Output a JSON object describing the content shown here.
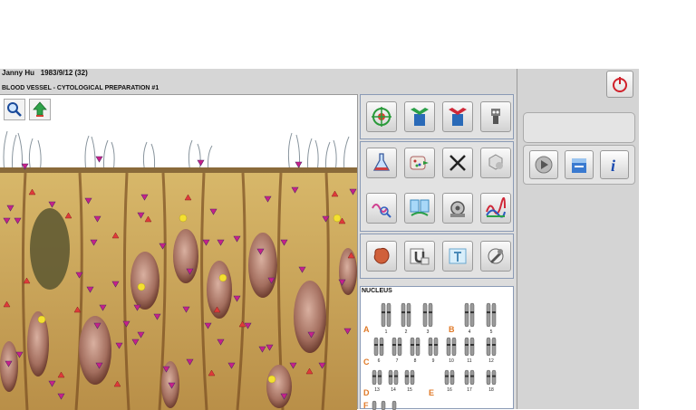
{
  "patient": {
    "name": "Janny  Hu",
    "dob": "1983/9/12 (32)"
  },
  "view": {
    "title": "BLOOD VESSEL - CYTOLOGICAL PREPARATION #1"
  },
  "viewer_tools": [
    {
      "name": "zoom-magnifier-icon"
    },
    {
      "name": "up-arrow-icon"
    }
  ],
  "tool_groups": [
    [
      {
        "name": "target-icon"
      },
      {
        "name": "cube-in-icon"
      },
      {
        "name": "cube-out-icon"
      },
      {
        "name": "robot-tool-icon"
      }
    ],
    [
      {
        "name": "flask-icon"
      },
      {
        "name": "dots-scan-icon"
      },
      {
        "name": "close-x-icon"
      },
      {
        "name": "molecule-icon"
      },
      {
        "name": "wave-zoom-icon"
      },
      {
        "name": "compare-icon"
      },
      {
        "name": "gear-machine-icon"
      },
      {
        "name": "spectrum-icon"
      }
    ],
    [
      {
        "name": "organ-icon"
      },
      {
        "name": "magnet-icon"
      },
      {
        "name": "clipboard-icon"
      },
      {
        "name": "wrench-icon"
      }
    ]
  ],
  "nucleus": {
    "title": "NUCLEUS",
    "groups": [
      "A",
      "B",
      "C",
      "D",
      "E",
      "F"
    ],
    "numbers": [
      "1",
      "2",
      "3",
      "4",
      "5",
      "6",
      "7",
      "8",
      "9",
      "10",
      "11",
      "12",
      "13",
      "14",
      "15",
      "16",
      "17",
      "18"
    ]
  },
  "right_panel": {
    "buttons": [
      {
        "name": "play-icon"
      },
      {
        "name": "database-icon"
      },
      {
        "name": "info-icon"
      }
    ]
  },
  "colors": {
    "accent_red": "#d0202a",
    "marker_magenta": "#c8208a",
    "marker_red": "#e03a3a",
    "marker_yellow": "#f4e030",
    "tissue": "#c9a25a"
  }
}
